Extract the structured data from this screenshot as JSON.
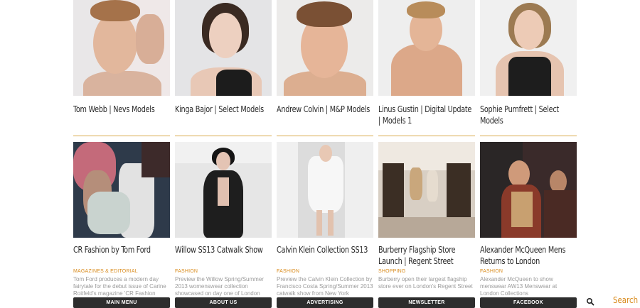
{
  "models": [
    {
      "title": "Tom Webb | Nevs Models"
    },
    {
      "title": "Kinga Bajor | Select Models"
    },
    {
      "title": "Andrew Colvin | M&P Models"
    },
    {
      "title": "Linus Gustin | Digital Update | Models 1"
    },
    {
      "title": "Sophie Pumfrett | Select Models"
    }
  ],
  "articles": [
    {
      "title": "CR Fashion by Tom Ford",
      "category": "MAGAZINES & EDITORIAL",
      "excerpt": "Tom Ford produces a modern day fairytale for the debut issue of Carine Roitfeld's magazine 'CR Fashion Book'"
    },
    {
      "title": "Willow SS13 Catwalk Show",
      "category": "FASHION",
      "excerpt": "Preview the Willow Spring/Summer 2013 womenswear collection showcased on day one of London Fashion Week"
    },
    {
      "title": "Calvin Klein Collection SS13",
      "category": "FASHION",
      "excerpt": "Preview the Calvin Klein Collection by Francisco Costa Spring/Summer 2013 catwalk show from New York"
    },
    {
      "title": "Burberry Flagship Store Launch | Regent Street",
      "category": "SHOPPING",
      "excerpt": "Burberry open their largest flagship store ever on London's Regent Street"
    },
    {
      "title": "Alexander McQueen Mens Returns to London",
      "category": "FASHION",
      "excerpt": "Alexander McQueen to show menswear AW13 Menswear at London Collections"
    }
  ],
  "nav": {
    "main_menu": "MAIN MENU",
    "about_us": "ABOUT US",
    "advertising": "ADVERTISING",
    "newsletter": "NEWSLETTER",
    "facebook": "FACEBOOK"
  },
  "search": {
    "label": "Search",
    "icon": "search-icon"
  },
  "colors": {
    "accent": "#d98b1c",
    "divider": "#d9a94a",
    "nav_bg": "#2d2d2d"
  }
}
